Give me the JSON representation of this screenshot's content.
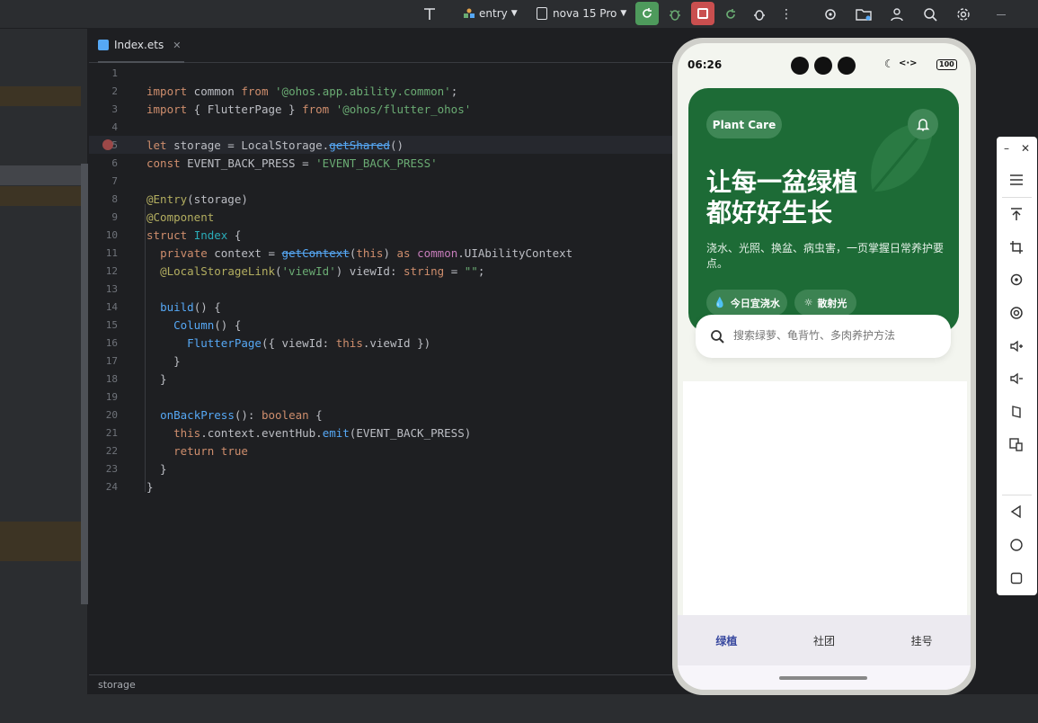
{
  "toolbar": {
    "module": "entry",
    "device": "nova 15 Pro"
  },
  "editor": {
    "tab_name": "Index.ets",
    "status_text": "storage",
    "line_numbers": [
      "1",
      "2",
      "3",
      "4",
      "5",
      "6",
      "7",
      "8",
      "9",
      "10",
      "11",
      "12",
      "13",
      "14",
      "15",
      "16",
      "17",
      "18",
      "19",
      "20",
      "21",
      "22",
      "23",
      "24"
    ]
  },
  "app": {
    "time": "06:26",
    "battery": "100",
    "badge": "Plant Care",
    "headline_1": "让每一盆绿植",
    "headline_2": "都好好生长",
    "subtitle": "浇水、光照、换盆、病虫害，一页掌握日常养护要点。",
    "chip_water": "今日宜浇水",
    "chip_light": "散射光",
    "search_placeholder": "搜索绿萝、龟背竹、多肉养护方法",
    "nav": [
      "绿植",
      "社团",
      "挂号"
    ]
  },
  "colors": {
    "hero_green": "#1d6b36",
    "nav_active": "#3a4aa0"
  }
}
